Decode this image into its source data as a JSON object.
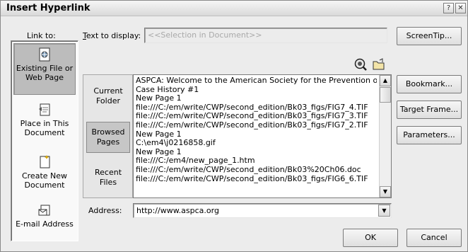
{
  "dialog": {
    "title": "Insert Hyperlink",
    "help_glyph": "?",
    "close_glyph": "✕"
  },
  "link_to": {
    "label": "Link to:",
    "items": [
      {
        "label_line1": "Existing File or",
        "label_line2": "Web Page",
        "icon": "web-page-icon",
        "selected": true
      },
      {
        "label_line1": "Place in This",
        "label_line2": "Document",
        "icon": "place-in-document-icon",
        "selected": false
      },
      {
        "label_line1": "Create New",
        "label_line2": "Document",
        "icon": "new-document-icon",
        "selected": false
      },
      {
        "label_line1": "E-mail Address",
        "label_line2": "",
        "icon": "email-icon",
        "selected": false
      }
    ]
  },
  "text_to_display": {
    "label": "Text to display:",
    "value": "<<Selection in Document>>"
  },
  "screentip_button": "ScreenTip...",
  "look_in": {
    "items": [
      {
        "line1": "Current",
        "line2": "Folder",
        "selected": false
      },
      {
        "line1": "Browsed",
        "line2": "Pages",
        "selected": true
      },
      {
        "line1": "Recent",
        "line2": "Files",
        "selected": false
      }
    ]
  },
  "icons": {
    "search_web": "search-web-icon",
    "browse_file": "browse-file-icon"
  },
  "history_list": [
    "ASPCA: Welcome to the American Society for the Prevention of",
    "Case History #1",
    "New Page 1",
    "file:///C:/em/write/CWP/second_edition/Bk03_figs/FIG7_4.TIF",
    "file:///C:/em/write/CWP/second_edition/Bk03_figs/FIG7_3.TIF",
    "file:///C:/em/write/CWP/second_edition/Bk03_figs/FIG7_2.TIF",
    "New Page 1",
    "C:\\em4\\j0216858.gif",
    "New Page 1",
    "file:///C:/em4/new_page_1.htm",
    "file:///C:/em/write/CWP/second_edition/Bk03%20Ch06.doc",
    "file:///C:/em/write/CWP/second_edition/Bk03_figs/FIG6_6.TIF"
  ],
  "right_buttons": {
    "bookmark": "Bookmark...",
    "target_frame": "Target Frame...",
    "parameters": "Parameters..."
  },
  "address": {
    "label": "Address:",
    "value": "http://www.aspca.org"
  },
  "footer": {
    "ok": "OK",
    "cancel": "Cancel"
  }
}
